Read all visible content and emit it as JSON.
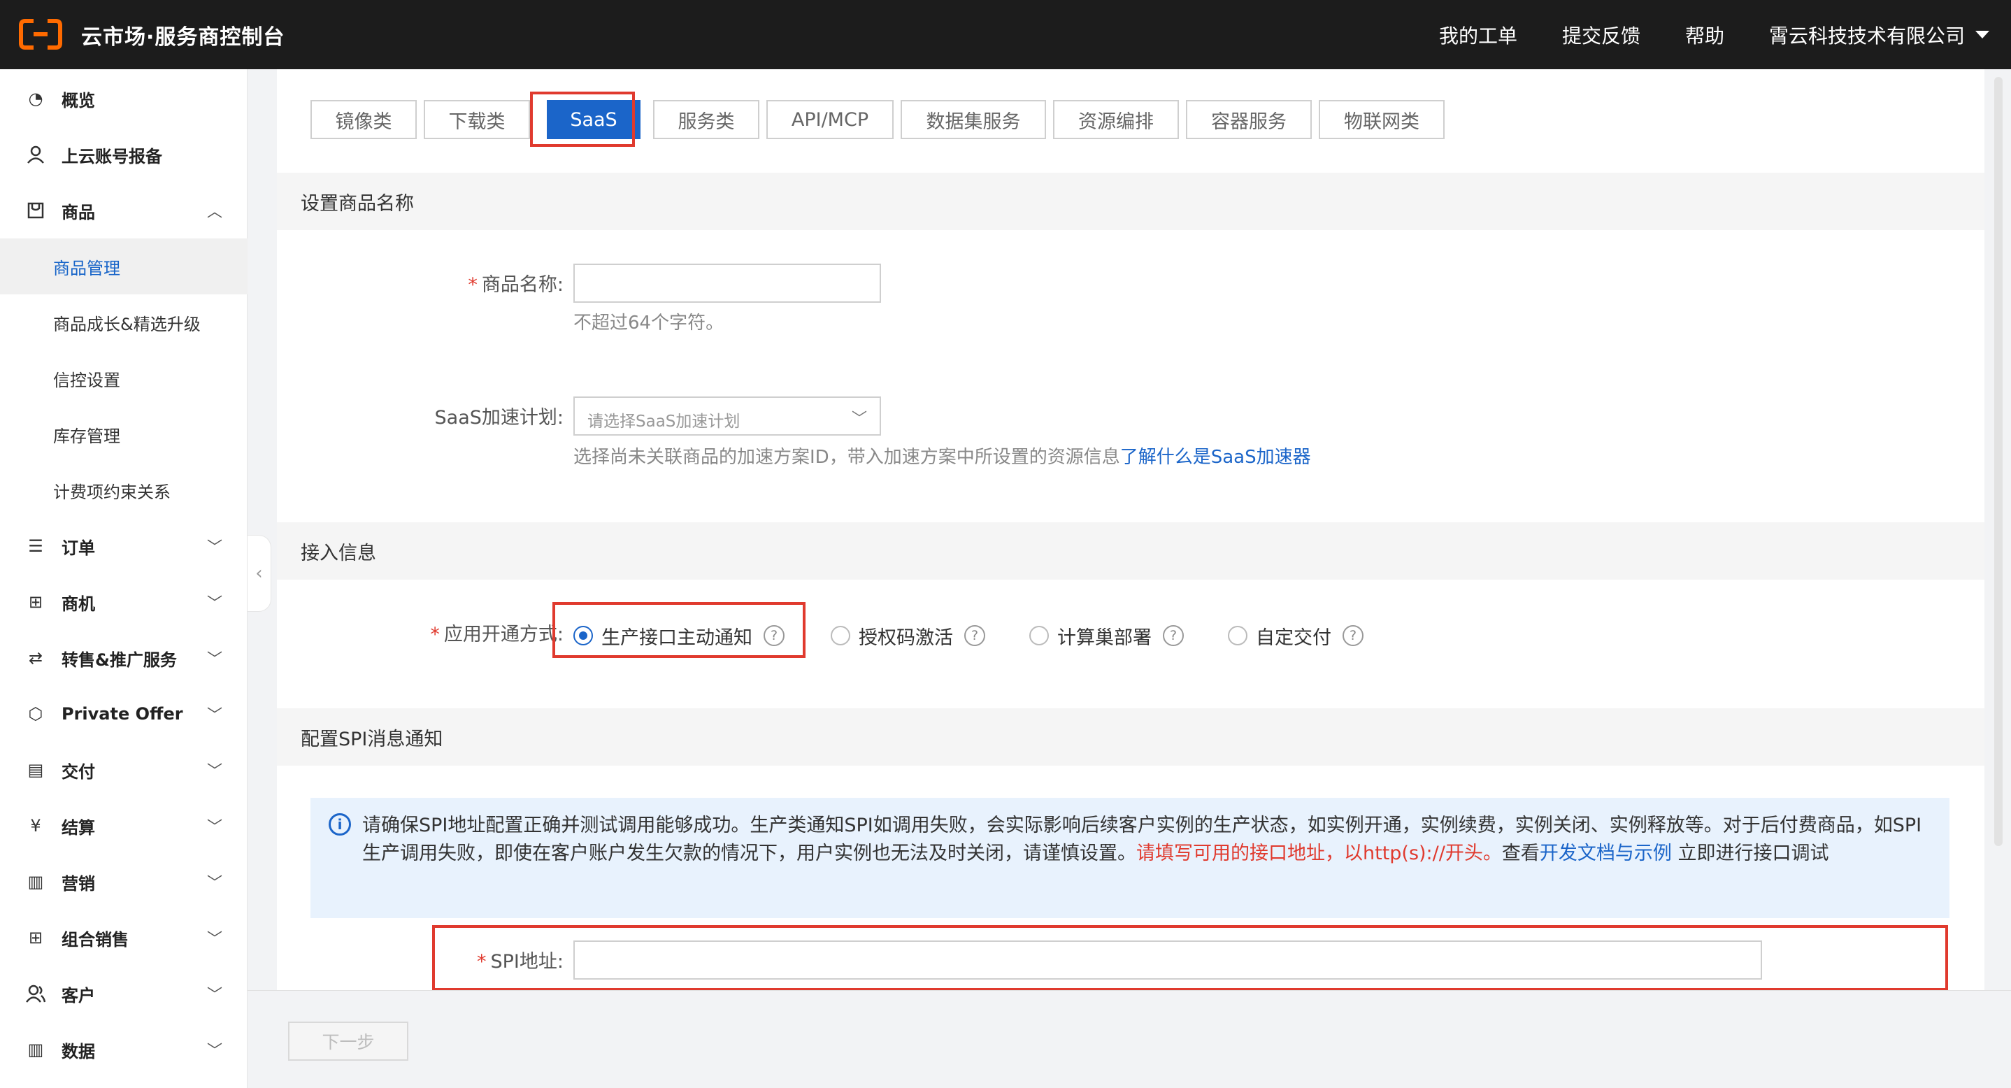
{
  "header": {
    "brand": "云市场·服务商控制台",
    "nav": [
      "我的工单",
      "提交反馈",
      "帮助"
    ],
    "company": "霄云科技技术有限公司"
  },
  "sidebar": {
    "overview": "概览",
    "cloud_account": "上云账号报备",
    "product": "商品",
    "product_sub": [
      "商品管理",
      "商品成长&精选升级",
      "信控设置",
      "库存管理",
      "计费项约束关系"
    ],
    "order": "订单",
    "opportunity": "商机",
    "resale": "转售&推广服务",
    "private_offer": "Private Offer",
    "delivery": "交付",
    "settlement": "结算",
    "marketing": "营销",
    "bundle": "组合销售",
    "customer": "客户",
    "data": "数据"
  },
  "tabs": [
    "镜像类",
    "下载类",
    "SaaS",
    "服务类",
    "API/MCP",
    "数据集服务",
    "资源编排",
    "容器服务",
    "物联网类"
  ],
  "active_tab": "SaaS",
  "sections": {
    "name": "设置商品名称",
    "access": "接入信息",
    "spi": "配置SPI消息通知"
  },
  "form": {
    "name_label": "商品名称:",
    "name_value": "",
    "name_help": "不超过64个字符。",
    "saas_label": "SaaS加速计划:",
    "saas_placeholder": "请选择SaaS加速计划",
    "saas_help": "选择尚未关联商品的加速方案ID，带入加速方案中所设置的资源信息",
    "saas_link": "了解什么是SaaS加速器",
    "open_label": "应用开通方式:",
    "open_options": [
      "生产接口主动通知",
      "授权码激活",
      "计算巢部署",
      "自定交付"
    ],
    "open_selected": "生产接口主动通知",
    "spi_label": "SPI地址:",
    "spi_value": ""
  },
  "notice": {
    "text1": "请确保SPI地址配置正确并测试调用能够成功。生产类通知SPI如调用失败，会实际影响后续客户实例的生产状态，如实例开通，实例续费，实例关闭、实例释放等。对于后付费商品，如SPI生产调用失败，即使在客户账户发生欠款的情况下，用户实例也无法及时关闭，请谨慎设置。",
    "red": "请填写可用的接口地址，以http(s)://开头。",
    "text2": "查看",
    "link": "开发文档与示例",
    "text3": " 立即进行接口调试"
  },
  "footer": {
    "next": "下一步"
  },
  "colors": {
    "topbar": "#1c1c1c",
    "accent": "#1b65c9",
    "highlight": "#e03a2e",
    "brand_orange": "#ff6a00"
  }
}
